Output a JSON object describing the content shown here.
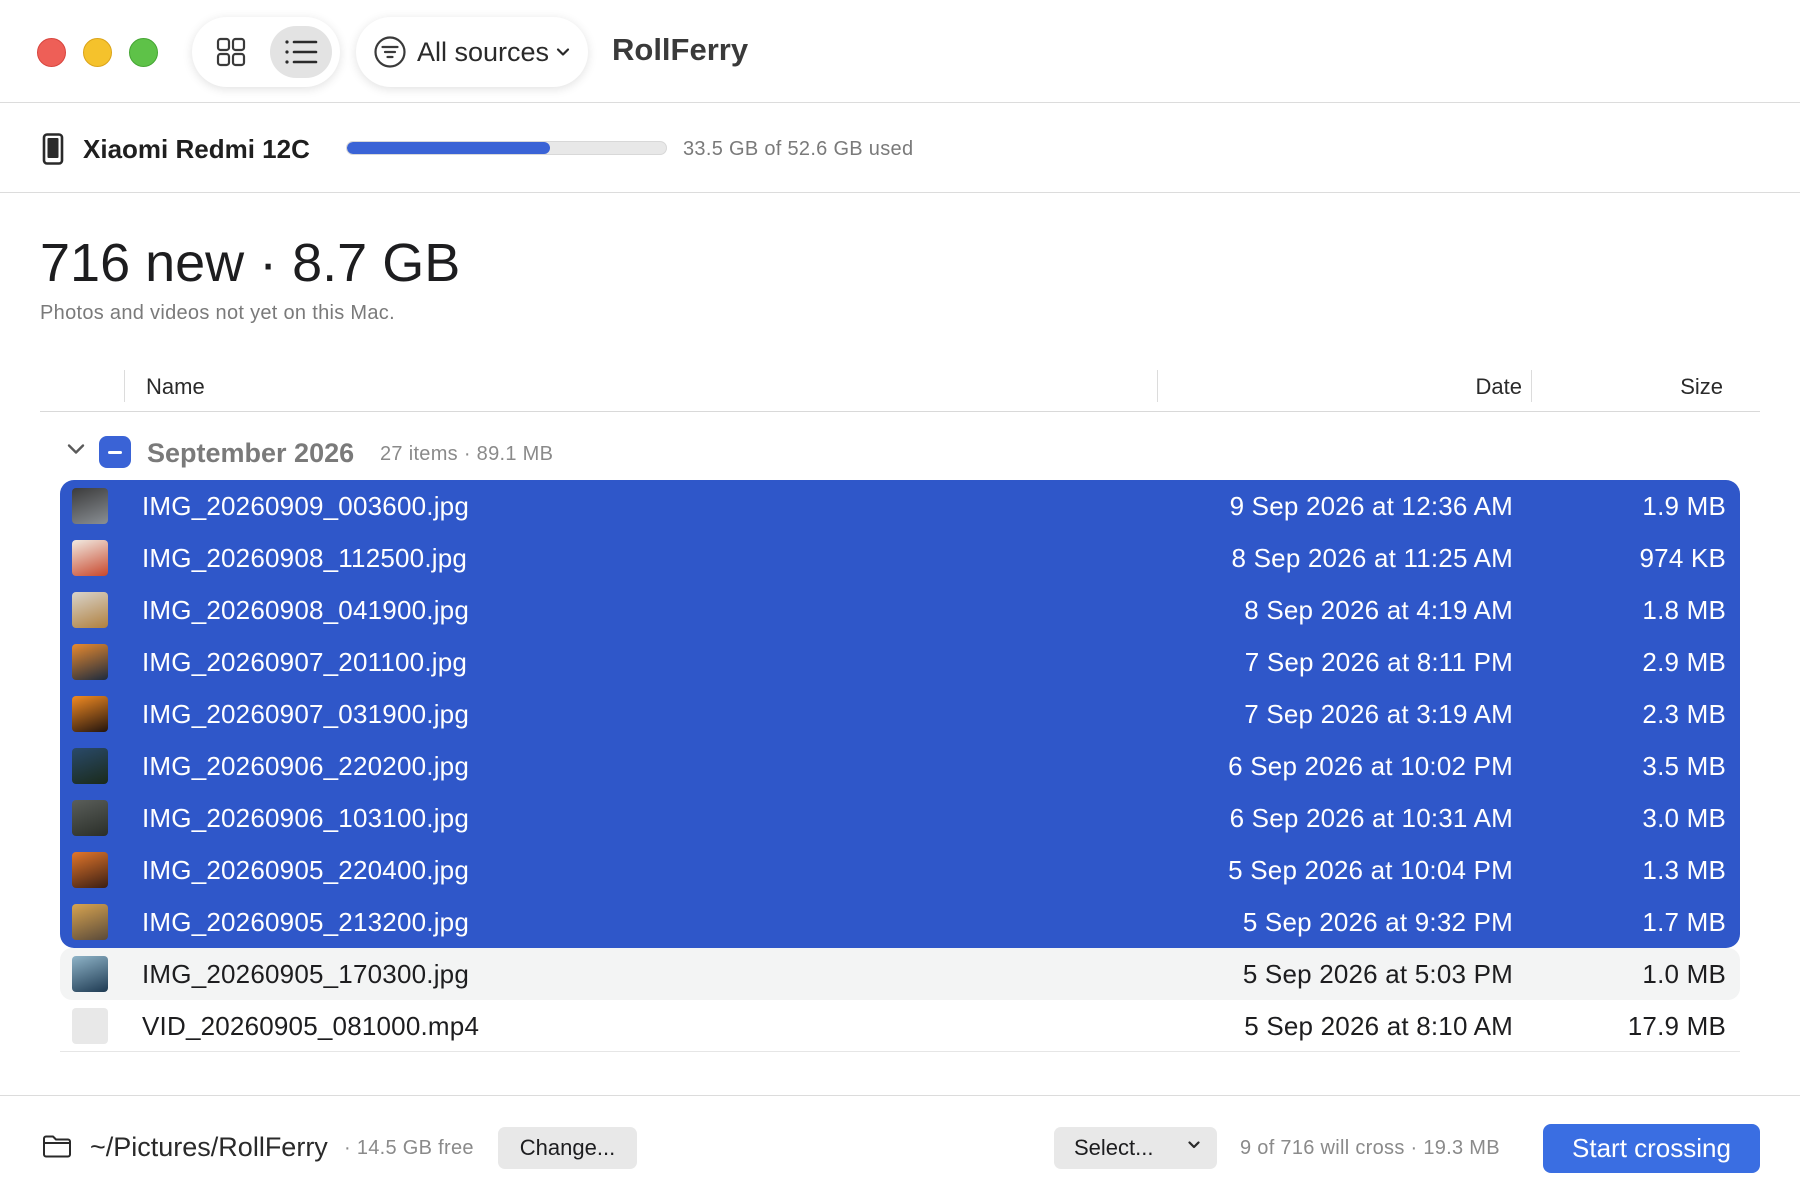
{
  "window": {
    "app_title": "RollFerry",
    "traffic_lights": [
      "close",
      "minimize",
      "zoom"
    ]
  },
  "toolbar": {
    "view_modes": [
      "grid",
      "list"
    ],
    "active_view": "list",
    "source_filter": "All sources"
  },
  "device": {
    "name": "Xiaomi Redmi 12C",
    "storage_text": "33.5 GB of 52.6 GB used",
    "storage_used_fraction": 0.637
  },
  "summary": {
    "title": "716 new · 8.7 GB",
    "subtitle": "Photos and videos not yet on this Mac."
  },
  "table": {
    "columns": [
      "Name",
      "Date",
      "Size"
    ]
  },
  "group": {
    "title": "September 2026",
    "meta": "27 items · 89.1 MB",
    "expanded": true,
    "selection_state": "mixed"
  },
  "files": [
    {
      "name": "IMG_20260909_003600.jpg",
      "date": "9 Sep 2026 at 12:36 AM",
      "size": "1.9 MB",
      "selected": true,
      "thumb": [
        "#3b3b3b",
        "#8a8f94"
      ]
    },
    {
      "name": "IMG_20260908_112500.jpg",
      "date": "8 Sep 2026 at 11:25 AM",
      "size": "974 KB",
      "selected": true,
      "thumb": [
        "#f1ebe2",
        "#c8472c"
      ]
    },
    {
      "name": "IMG_20260908_041900.jpg",
      "date": "8 Sep 2026 at 4:19 AM",
      "size": "1.8 MB",
      "selected": true,
      "thumb": [
        "#d9d4cc",
        "#b0803e"
      ]
    },
    {
      "name": "IMG_20260907_201100.jpg",
      "date": "7 Sep 2026 at 8:11 PM",
      "size": "2.9 MB",
      "selected": true,
      "thumb": [
        "#e88a2e",
        "#1c2a3e"
      ]
    },
    {
      "name": "IMG_20260907_031900.jpg",
      "date": "7 Sep 2026 at 3:19 AM",
      "size": "2.3 MB",
      "selected": true,
      "thumb": [
        "#f28b22",
        "#22140e"
      ]
    },
    {
      "name": "IMG_20260906_220200.jpg",
      "date": "6 Sep 2026 at 10:02 PM",
      "size": "3.5 MB",
      "selected": true,
      "thumb": [
        "#2a4a6a",
        "#1a2a1a"
      ]
    },
    {
      "name": "IMG_20260906_103100.jpg",
      "date": "6 Sep 2026 at 10:31 AM",
      "size": "3.0 MB",
      "selected": true,
      "thumb": [
        "#5a5e5a",
        "#2a2e28"
      ]
    },
    {
      "name": "IMG_20260905_220400.jpg",
      "date": "5 Sep 2026 at 10:04 PM",
      "size": "1.3 MB",
      "selected": true,
      "thumb": [
        "#e2762a",
        "#3a1e14"
      ]
    },
    {
      "name": "IMG_20260905_213200.jpg",
      "date": "5 Sep 2026 at 9:32 PM",
      "size": "1.7 MB",
      "selected": true,
      "thumb": [
        "#d8a450",
        "#5a4a3a"
      ]
    },
    {
      "name": "IMG_20260905_170300.jpg",
      "date": "5 Sep 2026 at 5:03 PM",
      "size": "1.0 MB",
      "selected": false,
      "thumb": [
        "#8fb4c8",
        "#1e3a52"
      ]
    },
    {
      "name": "VID_20260905_081000.mp4",
      "date": "5 Sep 2026 at 8:10 AM",
      "size": "17.9 MB",
      "selected": false,
      "thumb": [
        "#e8e8e8",
        "#e8e8e8"
      ]
    }
  ],
  "footer": {
    "destination_path": "~/Pictures/RollFerry",
    "free_space": "· 14.5 GB free",
    "change_label": "Change...",
    "select_label": "Select...",
    "cross_info": "9 of 716 will cross · 19.3 MB",
    "start_label": "Start crossing"
  },
  "colors": {
    "accent": "#3a63d6",
    "selection": "#2f57c9",
    "primary_button": "#3a6ee2",
    "close": "#ee5f57",
    "minimize": "#f5c22c",
    "zoom": "#5ec248"
  }
}
